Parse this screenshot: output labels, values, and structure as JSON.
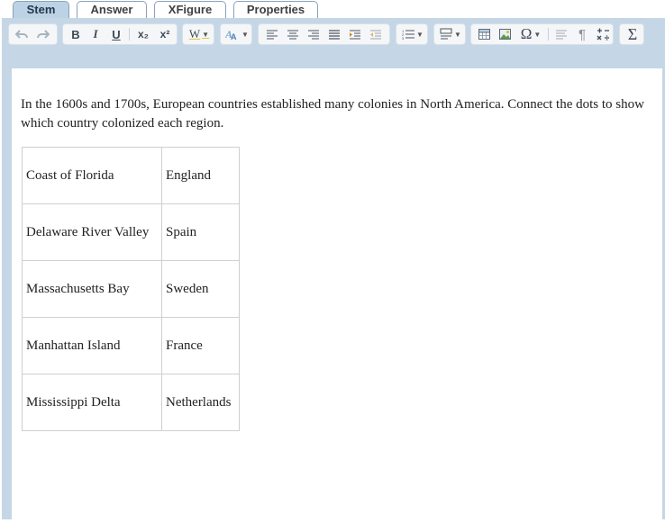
{
  "tabs": [
    {
      "label": "Stem",
      "active": true
    },
    {
      "label": "Answer"
    },
    {
      "label": "XFigure"
    },
    {
      "label": "Properties"
    }
  ],
  "toolbar": {
    "icons": [
      "undo-icon",
      "redo-icon",
      "bold-icon",
      "italic-icon",
      "underline-icon",
      "subscript-icon",
      "superscript-icon",
      "word-format-icon",
      "text-style-icon",
      "align-left-icon",
      "align-center-icon",
      "align-right-icon",
      "justify-icon",
      "indent-icon",
      "outdent-icon",
      "numbered-list-icon",
      "block-format-icon",
      "table-icon",
      "image-icon",
      "omega-icon",
      "paragraph-format-icon",
      "pilcrow-icon",
      "math-operators-icon",
      "sigma-icon"
    ],
    "bold": "B",
    "italic": "I",
    "underline": "U",
    "subscript": "x₂",
    "superscript": "x²",
    "word": "W",
    "omega": "Ω",
    "pilcrow": "¶",
    "sigma": "Σ"
  },
  "stem": {
    "text": "In the 1600s and 1700s, European countries established many colonies in North America. Connect the dots to show which country colonized each region."
  },
  "table": {
    "rows": [
      [
        "Coast of Florida",
        "England"
      ],
      [
        "Delaware River Valley",
        "Spain"
      ],
      [
        "Massachusetts Bay",
        "Sweden"
      ],
      [
        "Manhattan Island",
        "France"
      ],
      [
        "Mississippi Delta",
        "Netherlands"
      ]
    ]
  }
}
